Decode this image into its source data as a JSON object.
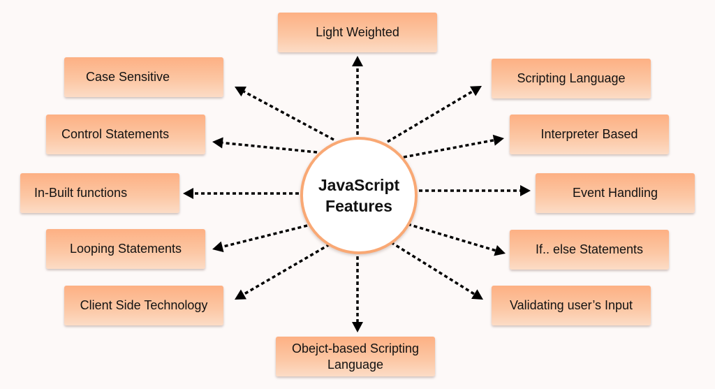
{
  "diagram": {
    "center": {
      "line1": "JavaScript",
      "line2": "Features"
    },
    "features": [
      {
        "id": "light-weighted",
        "label": "Light Weighted"
      },
      {
        "id": "case-sensitive",
        "label": "Case Sensitive"
      },
      {
        "id": "scripting-language",
        "label": "Scripting Language"
      },
      {
        "id": "control-statements",
        "label": "Control Statements"
      },
      {
        "id": "interpreter-based",
        "label": "Interpreter Based"
      },
      {
        "id": "in-built-functions",
        "label": "In-Built functions"
      },
      {
        "id": "event-handling",
        "label": "Event Handling"
      },
      {
        "id": "looping-statements",
        "label": "Looping Statements"
      },
      {
        "id": "if-else-statements",
        "label": "If.. else Statements"
      },
      {
        "id": "client-side-technology",
        "label": "Client Side Technology"
      },
      {
        "id": "validating-users-input",
        "label": "Validating user’s Input"
      },
      {
        "id": "object-based-scripting-language",
        "label": "Obejct-based Scripting",
        "label2": "Language"
      }
    ],
    "colors": {
      "box_top": "#fdb083",
      "box_bottom": "#fcdcc6",
      "hub_border": "#f9a874",
      "arrow": "#000000",
      "background": "#fdf9f8"
    }
  }
}
